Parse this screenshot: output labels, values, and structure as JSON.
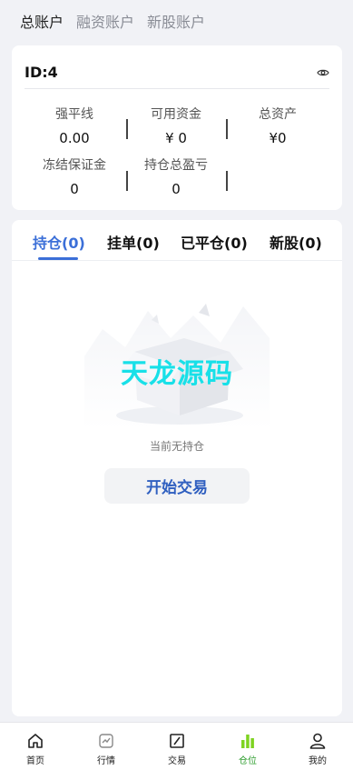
{
  "top_tabs": [
    {
      "label": "总账户",
      "active": true
    },
    {
      "label": "融资账户",
      "active": false
    },
    {
      "label": "新股账户",
      "active": false
    }
  ],
  "account": {
    "id_label": "ID:4",
    "eye_icon": "eye-icon",
    "stats": [
      {
        "label": "强平线",
        "value": "0.00"
      },
      {
        "label": "可用资金",
        "value": "¥ 0"
      },
      {
        "label": "总资产",
        "value": "¥0"
      },
      {
        "label": "冻结保证金",
        "value": "0"
      },
      {
        "label": "持仓总盈亏",
        "value": "0"
      }
    ]
  },
  "position_tabs": [
    {
      "label": "持仓(0)",
      "active": true
    },
    {
      "label": "挂单(0)",
      "active": false
    },
    {
      "label": "已平仓(0)",
      "active": false
    },
    {
      "label": "新股(0)",
      "active": false
    }
  ],
  "empty": {
    "watermark": "天龙源码",
    "message": "当前无持仓",
    "button_label": "开始交易"
  },
  "bottom_nav": [
    {
      "label": "首页",
      "icon": "home-icon",
      "active": false
    },
    {
      "label": "行情",
      "icon": "chart-line-icon",
      "active": false
    },
    {
      "label": "交易",
      "icon": "trade-icon",
      "active": false
    },
    {
      "label": "仓位",
      "icon": "bar-chart-icon",
      "active": true
    },
    {
      "label": "我的",
      "icon": "user-icon",
      "active": false
    }
  ],
  "colors": {
    "accent": "#3b6fd8",
    "nav_active": "#7ed321",
    "watermark": "#18e0e8"
  }
}
